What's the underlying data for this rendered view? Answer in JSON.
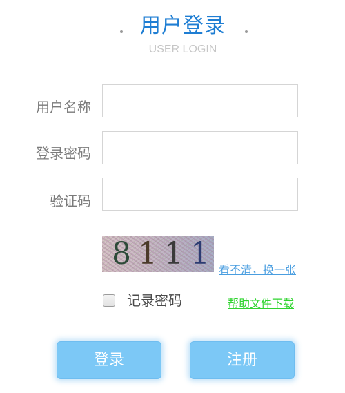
{
  "header": {
    "title": "用户登录",
    "subtitle": "USER LOGIN"
  },
  "form": {
    "username": {
      "label": "用户名称",
      "value": "",
      "placeholder": ""
    },
    "password": {
      "label": "登录密码",
      "value": "",
      "placeholder": ""
    },
    "captcha": {
      "label": "验证码",
      "value": "",
      "placeholder": ""
    }
  },
  "captcha_image": {
    "chars": [
      "8",
      "1",
      "1",
      "1"
    ],
    "refresh_link": "看不清，换一张"
  },
  "remember": {
    "label": "记录密码",
    "checked": false
  },
  "help_link": "帮助文件下载",
  "buttons": {
    "login": "登录",
    "register": "注册"
  },
  "colors": {
    "title": "#1f7ed3",
    "subtitle": "#c6c6c6",
    "refresh_link": "#4a9ee0",
    "help_link": "#2fd42f",
    "button_bg": "#7cc8f6"
  }
}
